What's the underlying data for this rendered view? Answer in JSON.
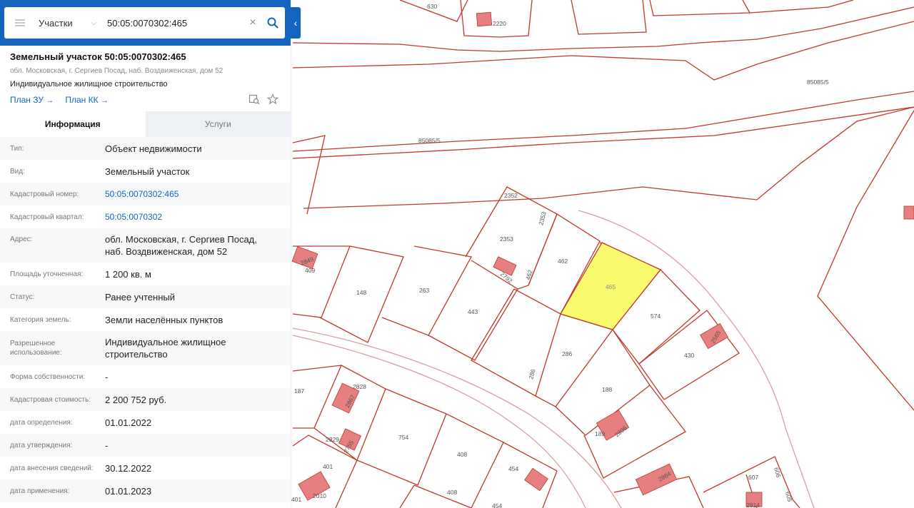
{
  "search": {
    "layer": "Участки",
    "query": "50:05:0070302:465"
  },
  "object": {
    "title": "Земельный участок 50:05:0070302:465",
    "address": "обл. Московская, г. Сергиев Посад, наб. Воздвиженская, дом 52",
    "use": "Индивидуальное жилищное строительство",
    "links": [
      "План ЗУ",
      "План КК"
    ]
  },
  "tabs": [
    "Информация",
    "Услуги"
  ],
  "fields": [
    {
      "k": "Тип:",
      "v": "Объект недвижимости"
    },
    {
      "k": "Вид:",
      "v": "Земельный участок"
    },
    {
      "k": "Кадастровый номер:",
      "v": "50:05:0070302:465",
      "link": true
    },
    {
      "k": "Кадастровый квартал:",
      "v": "50:05:0070302",
      "link": true
    },
    {
      "k": "Адрес:",
      "v": "обл. Московская, г. Сергиев Посад, наб. Воздвиженская, дом 52"
    },
    {
      "k": "Площадь уточненная:",
      "v": "1 200 кв. м"
    },
    {
      "k": "Статус:",
      "v": "Ранее учтенный"
    },
    {
      "k": "Категория земель:",
      "v": "Земли населённых пунктов"
    },
    {
      "k": "Разрешенное использование:",
      "v": "Индивидуальное жилищное строительство"
    },
    {
      "k": "Форма собственности:",
      "v": "-"
    },
    {
      "k": "Кадастровая стоимость:",
      "v": "2 200 752 руб."
    },
    {
      "k": "дата определения:",
      "v": "01.01.2022"
    },
    {
      "k": "дата утверждения:",
      "v": "-"
    },
    {
      "k": "дата внесения сведений:",
      "v": "30.12.2022"
    },
    {
      "k": "дата применения:",
      "v": "01.01.2023"
    }
  ],
  "map": {
    "selected_parcel": "465",
    "parcel_labels": [
      "630",
      "2220",
      "85085/5",
      "85085/5",
      "2352",
      "2353",
      "2353",
      "462",
      "462",
      "2792",
      "465",
      "574",
      "2849",
      "409",
      "148",
      "263",
      "443",
      "286",
      "286",
      "188",
      "430",
      "2565",
      "187",
      "2828",
      "2867",
      "2829",
      "2755",
      "754",
      "408",
      "408",
      "454",
      "454",
      "401",
      "2010",
      "401",
      "189",
      "2806",
      "2864",
      "607",
      "606",
      "605",
      "2814"
    ],
    "colors": {
      "boundary": "#c0392b",
      "selected_fill": "#fafa6e",
      "building": "#e57f80"
    }
  }
}
